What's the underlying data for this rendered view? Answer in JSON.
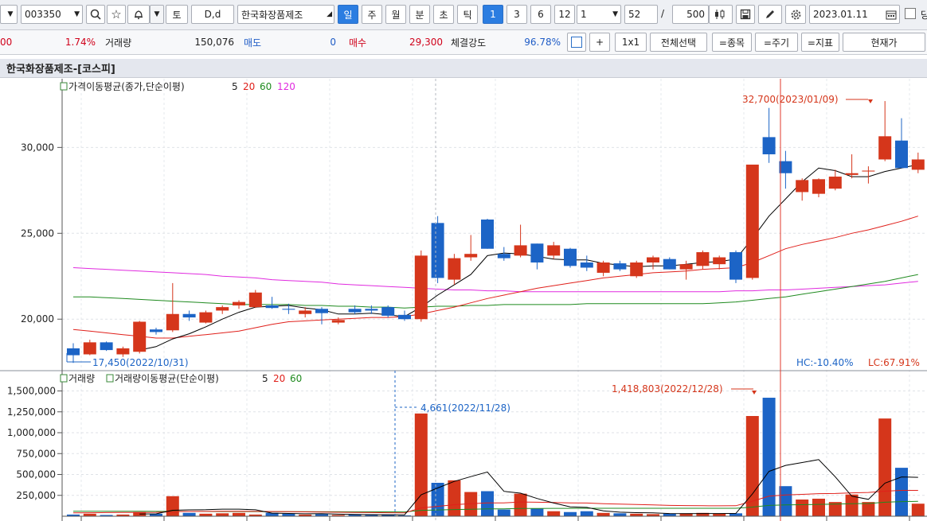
{
  "toolbar": {
    "code": "003350",
    "date_type_label": "토",
    "period_label": "D,d",
    "stock_name": "한국화장품제조",
    "period_tabs": [
      "일",
      "주",
      "월",
      "분",
      "초",
      "틱"
    ],
    "active_tab": "일",
    "period_nums": [
      "1",
      "3",
      "6",
      "12"
    ],
    "active_num": "1",
    "unit_value": "1",
    "lookback_value": "52",
    "slash": "/",
    "count_value": "500",
    "date_value": "2023.01.11"
  },
  "infobar": {
    "prev_fragment": "00",
    "change_pct": "1.74%",
    "volume_label": "거래량",
    "volume_value": "150,076",
    "sell_label": "매도",
    "sell_value": "0",
    "buy_label": "매수",
    "buy_value": "29,300",
    "strength_label": "체결강도",
    "strength_value": "96.78%",
    "plus_label": "+",
    "ratio_label": "1x1",
    "select_all_label": "전체선택",
    "item_label": "=종목",
    "cycle_label": "=주기",
    "index_label": "=지표",
    "current_label": "현재가"
  },
  "chart_title": "한국화장품제조-[코스피]",
  "price_legend": {
    "title": "가격이동평균(종가,단순이평)",
    "p5": "5",
    "p20": "20",
    "p60": "60",
    "p120": "120"
  },
  "volume_legend": {
    "title": "거래량",
    "title2": "거래량이동평균(단순이평)",
    "p5": "5",
    "p20": "20",
    "p60": "60"
  },
  "annotations": {
    "price_high": "32,700(2023/01/09)",
    "price_low": "17,450(2022/10/31)",
    "vol_high": "1,418,803(2022/12/28)",
    "vol_low": "4,661(2022/11/28)",
    "hc": "HC:-10.40%",
    "lc": "LC:67.91%"
  },
  "colors": {
    "up": "#d5361b",
    "down": "#1c64c6",
    "ma5": "#000000",
    "ma20": "#e0201b",
    "ma60": "#1f8a1f",
    "ma120": "#e02adf"
  },
  "chart_data": [
    {
      "type": "candlestick",
      "title": "가격이동평균(종가,단순이평)",
      "ylim": [
        17000,
        34000
      ],
      "yticks": [
        "20,000",
        "25,000",
        "30,000"
      ],
      "candles": [
        {
          "o": 18300,
          "h": 18600,
          "l": 17450,
          "c": 17900
        },
        {
          "o": 17950,
          "h": 18800,
          "l": 17900,
          "c": 18650
        },
        {
          "o": 18650,
          "h": 18700,
          "l": 18150,
          "c": 18200
        },
        {
          "o": 17950,
          "h": 18400,
          "l": 17800,
          "c": 18300
        },
        {
          "o": 18100,
          "h": 19900,
          "l": 18000,
          "c": 19850
        },
        {
          "o": 19400,
          "h": 19500,
          "l": 19100,
          "c": 19250
        },
        {
          "o": 19350,
          "h": 22100,
          "l": 19250,
          "c": 20300
        },
        {
          "o": 20300,
          "h": 20500,
          "l": 19900,
          "c": 20100
        },
        {
          "o": 19800,
          "h": 20500,
          "l": 19750,
          "c": 20400
        },
        {
          "o": 20500,
          "h": 20800,
          "l": 20300,
          "c": 20700
        },
        {
          "o": 20800,
          "h": 21100,
          "l": 20600,
          "c": 21000
        },
        {
          "o": 20700,
          "h": 21700,
          "l": 20650,
          "c": 21550
        },
        {
          "o": 20800,
          "h": 21300,
          "l": 20600,
          "c": 20650
        },
        {
          "o": 20600,
          "h": 20900,
          "l": 20300,
          "c": 20550
        },
        {
          "o": 20300,
          "h": 20700,
          "l": 20100,
          "c": 20500
        },
        {
          "o": 20600,
          "h": 20700,
          "l": 19700,
          "c": 20350
        },
        {
          "o": 19800,
          "h": 20100,
          "l": 19700,
          "c": 19950
        },
        {
          "o": 20600,
          "h": 20800,
          "l": 20300,
          "c": 20400
        },
        {
          "o": 20600,
          "h": 20800,
          "l": 20300,
          "c": 20500
        },
        {
          "o": 20700,
          "h": 20800,
          "l": 20100,
          "c": 20200
        },
        {
          "o": 20250,
          "h": 20500,
          "l": 19900,
          "c": 20000
        },
        {
          "o": 20000,
          "h": 24000,
          "l": 19850,
          "c": 23700
        },
        {
          "o": 25600,
          "h": 26000,
          "l": 22100,
          "c": 22400
        },
        {
          "o": 22300,
          "h": 23800,
          "l": 22000,
          "c": 23550
        },
        {
          "o": 23600,
          "h": 24900,
          "l": 23400,
          "c": 23800
        },
        {
          "o": 25800,
          "h": 25850,
          "l": 24100,
          "c": 24100
        },
        {
          "o": 23800,
          "h": 24200,
          "l": 23400,
          "c": 23550
        },
        {
          "o": 23700,
          "h": 25500,
          "l": 23600,
          "c": 24300
        },
        {
          "o": 24400,
          "h": 24400,
          "l": 22900,
          "c": 23300
        },
        {
          "o": 23700,
          "h": 24500,
          "l": 23500,
          "c": 24300
        },
        {
          "o": 24100,
          "h": 24150,
          "l": 23000,
          "c": 23100
        },
        {
          "o": 23300,
          "h": 23700,
          "l": 22800,
          "c": 23000
        },
        {
          "o": 22700,
          "h": 23400,
          "l": 22500,
          "c": 23300
        },
        {
          "o": 23250,
          "h": 23400,
          "l": 22800,
          "c": 22900
        },
        {
          "o": 22500,
          "h": 23400,
          "l": 22400,
          "c": 23300
        },
        {
          "o": 23300,
          "h": 23700,
          "l": 22900,
          "c": 23600
        },
        {
          "o": 23500,
          "h": 23600,
          "l": 22900,
          "c": 22900
        },
        {
          "o": 22900,
          "h": 23400,
          "l": 22300,
          "c": 23200
        },
        {
          "o": 23100,
          "h": 24000,
          "l": 22900,
          "c": 23900
        },
        {
          "o": 23200,
          "h": 23700,
          "l": 22900,
          "c": 23600
        },
        {
          "o": 23900,
          "h": 24000,
          "l": 22100,
          "c": 22300
        },
        {
          "o": 22400,
          "h": 29000,
          "l": 22300,
          "c": 29000
        },
        {
          "o": 30600,
          "h": 32300,
          "l": 29100,
          "c": 29600
        },
        {
          "o": 29200,
          "h": 29800,
          "l": 27600,
          "c": 28500
        },
        {
          "o": 27400,
          "h": 28200,
          "l": 26900,
          "c": 28100
        },
        {
          "o": 27300,
          "h": 28200,
          "l": 27100,
          "c": 28150
        },
        {
          "o": 27600,
          "h": 28700,
          "l": 27500,
          "c": 28300
        },
        {
          "o": 28400,
          "h": 29600,
          "l": 28200,
          "c": 28500
        },
        {
          "o": 28600,
          "h": 28900,
          "l": 27900,
          "c": 28650
        },
        {
          "o": 29300,
          "h": 32700,
          "l": 29200,
          "c": 30650
        },
        {
          "o": 30400,
          "h": 31700,
          "l": 28800,
          "c": 28800
        },
        {
          "o": 28700,
          "h": 29700,
          "l": 28500,
          "c": 29300
        }
      ],
      "ma5": [
        null,
        null,
        null,
        null,
        18200,
        18400,
        18850,
        19150,
        19550,
        20000,
        20400,
        20700,
        20750,
        20800,
        20650,
        20550,
        20300,
        20300,
        20350,
        20250,
        20150,
        20700,
        21400,
        22000,
        22600,
        23700,
        23850,
        23800,
        23650,
        23500,
        23450,
        23450,
        23250,
        23150,
        23050,
        23100,
        23100,
        23200,
        23300,
        23350,
        23500,
        24700,
        26000,
        27000,
        28000,
        28800,
        28650,
        28300,
        28300,
        28600,
        28800,
        29000
      ],
      "ma20": [
        19400,
        19300,
        19200,
        19100,
        19000,
        18900,
        18900,
        19000,
        19100,
        19200,
        19300,
        19500,
        19700,
        19850,
        19900,
        19950,
        20000,
        20050,
        20100,
        20100,
        20150,
        20300,
        20500,
        20700,
        20950,
        21200,
        21400,
        21600,
        21800,
        21950,
        22100,
        22250,
        22400,
        22500,
        22600,
        22700,
        22750,
        22800,
        22900,
        22950,
        23000,
        23300,
        23700,
        24100,
        24350,
        24550,
        24750,
        25000,
        25200,
        25450,
        25700,
        26000
      ],
      "ma60": [
        21300,
        21300,
        21250,
        21200,
        21150,
        21100,
        21050,
        21000,
        20950,
        20900,
        20850,
        20850,
        20850,
        20850,
        20800,
        20800,
        20750,
        20750,
        20700,
        20700,
        20650,
        20700,
        20750,
        20750,
        20800,
        20800,
        20850,
        20850,
        20850,
        20850,
        20850,
        20900,
        20900,
        20900,
        20900,
        20900,
        20900,
        20900,
        20900,
        20950,
        21000,
        21100,
        21200,
        21300,
        21450,
        21600,
        21750,
        21900,
        22050,
        22200,
        22400,
        22600
      ],
      "ma120": [
        23000,
        22950,
        22900,
        22850,
        22800,
        22750,
        22700,
        22650,
        22600,
        22500,
        22450,
        22400,
        22300,
        22250,
        22200,
        22150,
        22050,
        22000,
        21950,
        21900,
        21850,
        21800,
        21750,
        21700,
        21700,
        21650,
        21650,
        21600,
        21600,
        21600,
        21600,
        21600,
        21600,
        21600,
        21600,
        21600,
        21600,
        21600,
        21600,
        21600,
        21650,
        21650,
        21700,
        21700,
        21750,
        21800,
        21850,
        21900,
        21950,
        22000,
        22100,
        22200
      ]
    },
    {
      "type": "bar",
      "title": "거래량",
      "ylim": [
        0,
        1600000
      ],
      "yticks": [
        "250,000",
        "500,000",
        "750,000",
        "1,000,000",
        "1,250,000",
        "1,500,000"
      ],
      "volumes": [
        20000,
        30000,
        15000,
        20000,
        50000,
        30000,
        240000,
        40000,
        30000,
        35000,
        40000,
        20000,
        40000,
        30000,
        20000,
        25000,
        15000,
        20000,
        15000,
        15000,
        10000,
        1230000,
        400000,
        430000,
        290000,
        300000,
        80000,
        270000,
        90000,
        60000,
        50000,
        60000,
        40000,
        35000,
        30000,
        25000,
        30000,
        35000,
        40000,
        30000,
        35000,
        1200000,
        1418803,
        360000,
        200000,
        210000,
        170000,
        260000,
        170000,
        1170000,
        580000,
        150076
      ],
      "vma5": [
        null,
        null,
        null,
        null,
        27000,
        29000,
        71000,
        76000,
        78000,
        85000,
        85000,
        77000,
        37000,
        33000,
        30000,
        31000,
        25000,
        22000,
        19000,
        18000,
        17000,
        257000,
        338000,
        417000,
        474000,
        530000,
        298000,
        276000,
        212000,
        158000,
        112000,
        106000,
        64000,
        49000,
        43000,
        40000,
        32000,
        31000,
        32000,
        32000,
        34000,
        268000,
        537000,
        609000,
        643000,
        678000,
        472000,
        240000,
        202000,
        396000,
        470000,
        466000
      ],
      "vma20": [
        40000,
        42000,
        44000,
        45000,
        46000,
        47000,
        55000,
        57000,
        58000,
        59000,
        60000,
        58000,
        56000,
        54000,
        52000,
        50000,
        48000,
        46000,
        44000,
        42000,
        40000,
        100000,
        118000,
        138000,
        150000,
        160000,
        160000,
        170000,
        168000,
        165000,
        160000,
        158000,
        150000,
        145000,
        140000,
        135000,
        130000,
        128000,
        126000,
        125000,
        126000,
        180000,
        240000,
        255000,
        262000,
        270000,
        272000,
        280000,
        285000,
        300000,
        310000,
        310000
      ],
      "vma60": [
        60000,
        60000,
        60000,
        59000,
        59000,
        58000,
        58000,
        57000,
        57000,
        56000,
        56000,
        55000,
        55000,
        54000,
        54000,
        53000,
        53000,
        52000,
        52000,
        52000,
        51000,
        70000,
        75000,
        80000,
        84000,
        88000,
        89000,
        92000,
        93000,
        94000,
        94000,
        95000,
        95000,
        95000,
        95000,
        95000,
        95000,
        95000,
        95000,
        95000,
        95000,
        110000,
        130000,
        135000,
        138000,
        142000,
        145000,
        150000,
        152000,
        168000,
        175000,
        178000
      ]
    }
  ]
}
